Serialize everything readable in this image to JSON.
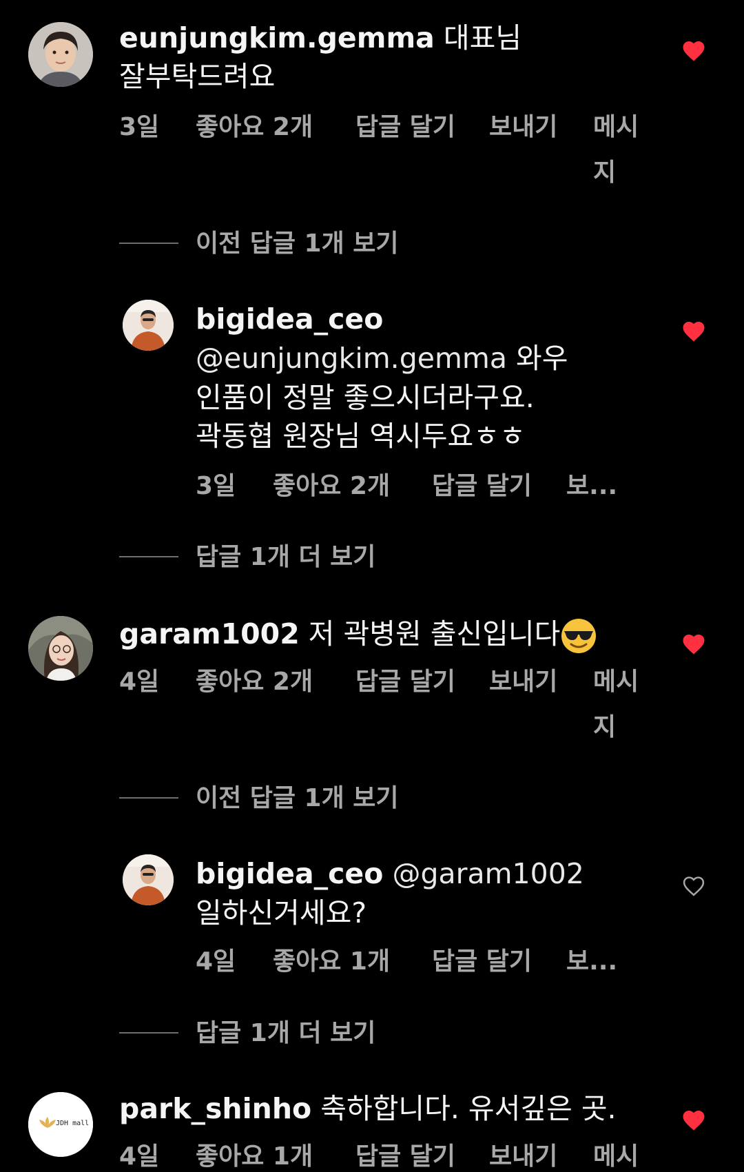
{
  "comments": [
    {
      "username": "eunjungkim.gemma",
      "text_line1": "대표님",
      "text_line2": "잘부탁드려요",
      "time": "3일",
      "likes": "좋아요 2개",
      "reply": "답글 달기",
      "send_line1": "보내기",
      "send_line2": "메시",
      "send_line3": "지",
      "view_replies": "이전 답글 1개 보기",
      "liked": true
    },
    {
      "username": "bigidea_ceo",
      "mention": "@eunjungkim.gemma",
      "text_after_mention": "와우",
      "text_line2": "인품이 정말 좋으시더라구요.",
      "text_line3": "곽동협 원장님 역시두요ㅎㅎ",
      "time": "3일",
      "likes": "좋아요 2개",
      "reply": "답글 달기",
      "send_trunc": "보...",
      "more_replies": "답글 1개 더 보기",
      "liked": true
    },
    {
      "username": "garam1002",
      "text": "저 곽병원 출신입니다",
      "emoji": "smiling-face-with-sunglasses",
      "time": "4일",
      "likes": "좋아요 2개",
      "reply": "답글 달기",
      "send_line1": "보내기",
      "send_line2": "메시",
      "send_line3": "지",
      "view_replies": "이전 답글 1개 보기",
      "liked": true
    },
    {
      "username": "bigidea_ceo",
      "mention": "@garam1002",
      "text_line2": "일하신거세요?",
      "time": "4일",
      "likes": "좋아요 1개",
      "reply": "답글 달기",
      "send_trunc": "보...",
      "more_replies": "답글 1개 더 보기",
      "liked": false
    },
    {
      "username": "park_shinho",
      "text": "축하합니다. 유서깊은 곳.",
      "avatar_logo": "JDH mall",
      "time": "4일",
      "likes": "좋아요 1개",
      "reply": "답글 달기",
      "send_line1": "보내기",
      "send_line2": "메시",
      "liked": true
    }
  ],
  "colors": {
    "background": "#000000",
    "text": "#f5f5f5",
    "meta": "#a8a8a8",
    "heart_liked": "#ff3040",
    "heart_outline": "#a8a8a8"
  }
}
